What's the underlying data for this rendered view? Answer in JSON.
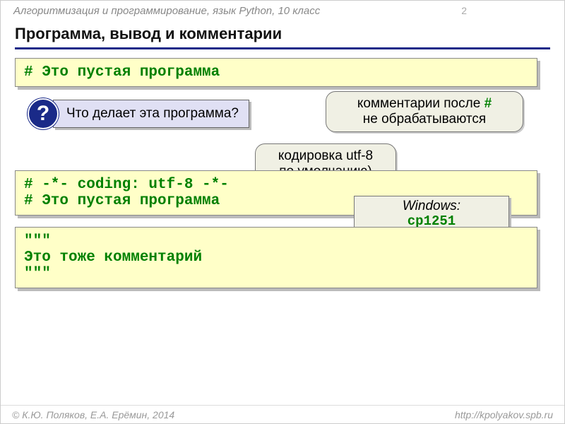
{
  "header": {
    "course": "Алгоритмизация и программирование, язык Python, 10 класс",
    "page": "2"
  },
  "title": "Программа, вывод и комментарии",
  "code1": {
    "line1": "# Это пустая программа"
  },
  "question": {
    "mark": "?",
    "text": "Что делает эта программа?"
  },
  "bubble1": {
    "line1_pre": "комментарии после ",
    "hash": "#",
    "line2": "не обрабатываются"
  },
  "bubble2": {
    "line1": "кодировка utf-8",
    "line2": "по умолчанию)"
  },
  "code2": {
    "line1": "# -*- coding: utf-8 -*-",
    "line2": "# Это пустая программа"
  },
  "windows": {
    "os": "Windows:",
    "enc": "cp1251"
  },
  "code3": {
    "line1": "\"\"\"",
    "line2": "Это тоже комментарий",
    "line3": "\"\"\""
  },
  "footer": {
    "copyright": "© К.Ю. Поляков, Е.А. Ерёмин, 2014",
    "url": "http://kpolyakov.spb.ru"
  }
}
